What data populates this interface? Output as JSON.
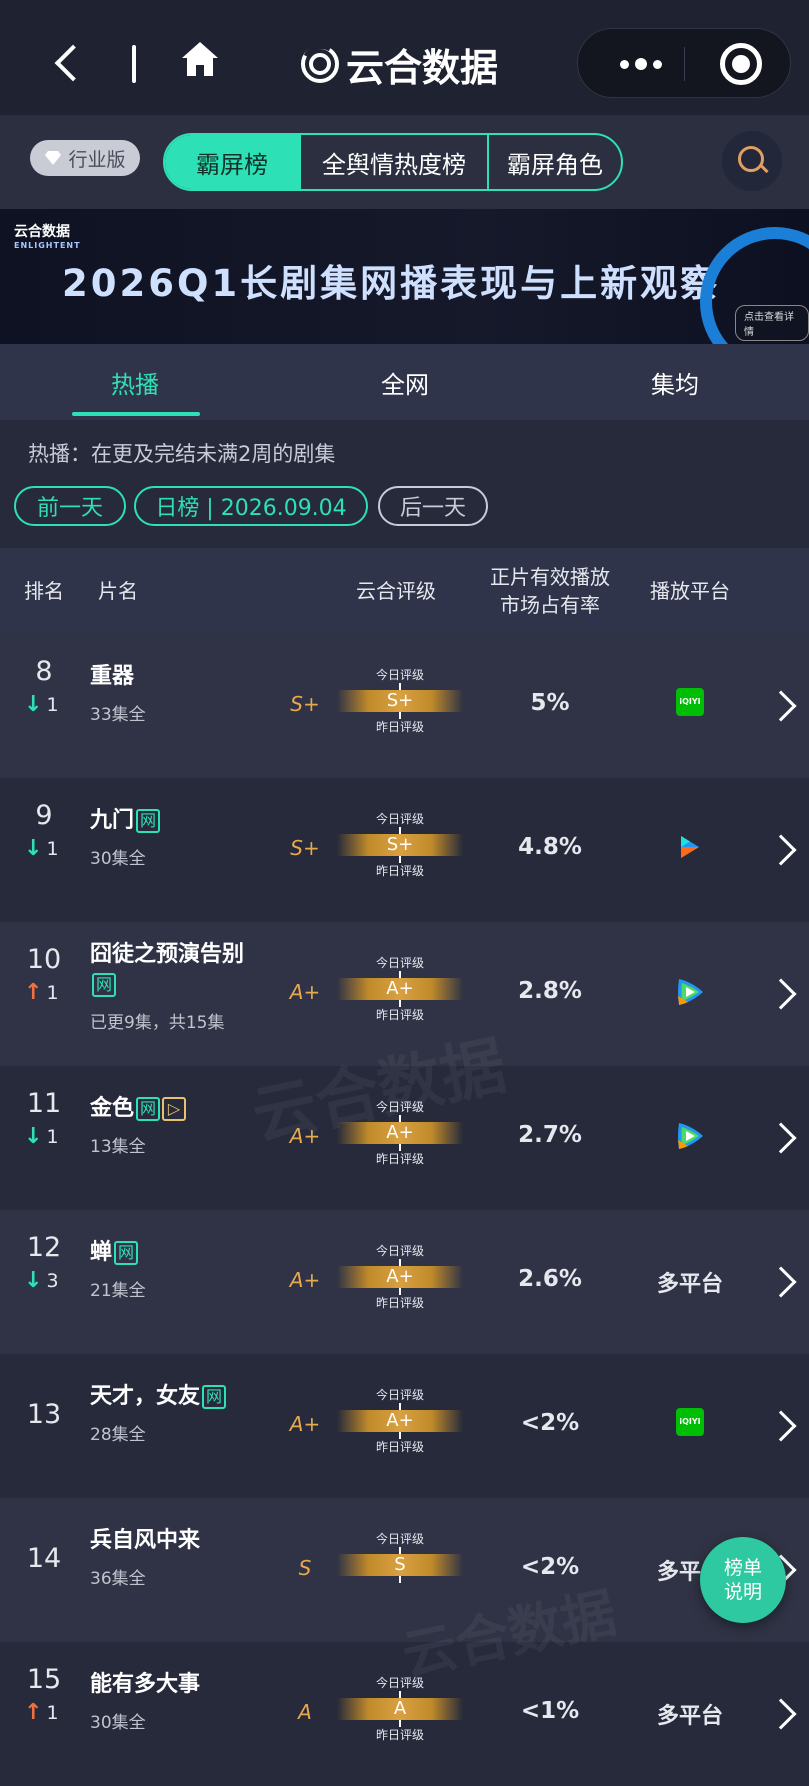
{
  "nav": {
    "title": "云合数据"
  },
  "tabbar": {
    "industry_label": "行业版",
    "segments": [
      "霸屏榜",
      "全舆情热度榜",
      "霸屏角色"
    ]
  },
  "banner": {
    "logo": "云合数据",
    "logo_en": "ENLIGHTENT",
    "title": "2026Q1长剧集网播表现与上新观察",
    "cta": "点击查看详情"
  },
  "subtabs": [
    "热播",
    "全网",
    "集均"
  ],
  "description": "热播：在更及完结未满2周的剧集",
  "datebar": {
    "prev": "前一天",
    "current": "日榜 | 2026.09.04",
    "next": "后一天"
  },
  "table": {
    "headers": {
      "rank": "排名",
      "title": "片名",
      "grade": "云合评级",
      "share": "正片有效播放\n市场占有率",
      "platform": "播放平台"
    },
    "today_label": "今日评级",
    "yesterday_label": "昨日评级",
    "rows": [
      {
        "rank": "8",
        "change_dir": "down",
        "change": "1",
        "title": "重器",
        "badges": [],
        "eps": "33集全",
        "grade": "S+",
        "today": "S+",
        "share": "5%",
        "platform": "iqiyi",
        "platform_text": "iQIYI"
      },
      {
        "rank": "9",
        "change_dir": "down",
        "change": "1",
        "title": "九门",
        "badges": [
          "网"
        ],
        "eps": "30集全",
        "grade": "S+",
        "today": "S+",
        "share": "4.8%",
        "platform": "youku",
        "platform_text": ""
      },
      {
        "rank": "10",
        "change_dir": "up",
        "change": "1",
        "title": "囧徒之预演告别",
        "badges": [
          "网"
        ],
        "eps": "已更9集，共15集",
        "grade": "A+",
        "today": "A+",
        "share": "2.8%",
        "platform": "tencent",
        "platform_text": ""
      },
      {
        "rank": "11",
        "change_dir": "down",
        "change": "1",
        "title": "金色",
        "badges": [
          "网",
          "▷"
        ],
        "eps": "13集全",
        "grade": "A+",
        "today": "A+",
        "share": "2.7%",
        "platform": "tencent",
        "platform_text": ""
      },
      {
        "rank": "12",
        "change_dir": "down",
        "change": "3",
        "title": "蝉",
        "badges": [
          "网"
        ],
        "eps": "21集全",
        "grade": "A+",
        "today": "A+",
        "share": "2.6%",
        "platform": "multi",
        "platform_text": "多平台"
      },
      {
        "rank": "13",
        "change_dir": "",
        "change": "",
        "title": "天才，女友",
        "badges": [
          "网"
        ],
        "eps": "28集全",
        "grade": "A+",
        "today": "A+",
        "share": "<2%",
        "platform": "iqiyi",
        "platform_text": "iQIYI"
      },
      {
        "rank": "14",
        "change_dir": "",
        "change": "",
        "title": "兵自风中来",
        "badges": [],
        "eps": "36集全",
        "grade": "S",
        "today": "S",
        "share": "<2%",
        "platform": "multi",
        "platform_text": "多平台"
      },
      {
        "rank": "15",
        "change_dir": "up",
        "change": "1",
        "title": "能有多大事",
        "badges": [],
        "eps": "30集全",
        "grade": "A",
        "today": "A",
        "share": "<1%",
        "platform": "multi",
        "platform_text": "多平台"
      }
    ]
  },
  "fab": {
    "label": "榜单\n说明"
  },
  "colors": {
    "accent": "#2ee0b5",
    "down": "#2ee0b5",
    "up": "#f07040",
    "grade": "#e8a850",
    "bg": "#262a3b"
  }
}
